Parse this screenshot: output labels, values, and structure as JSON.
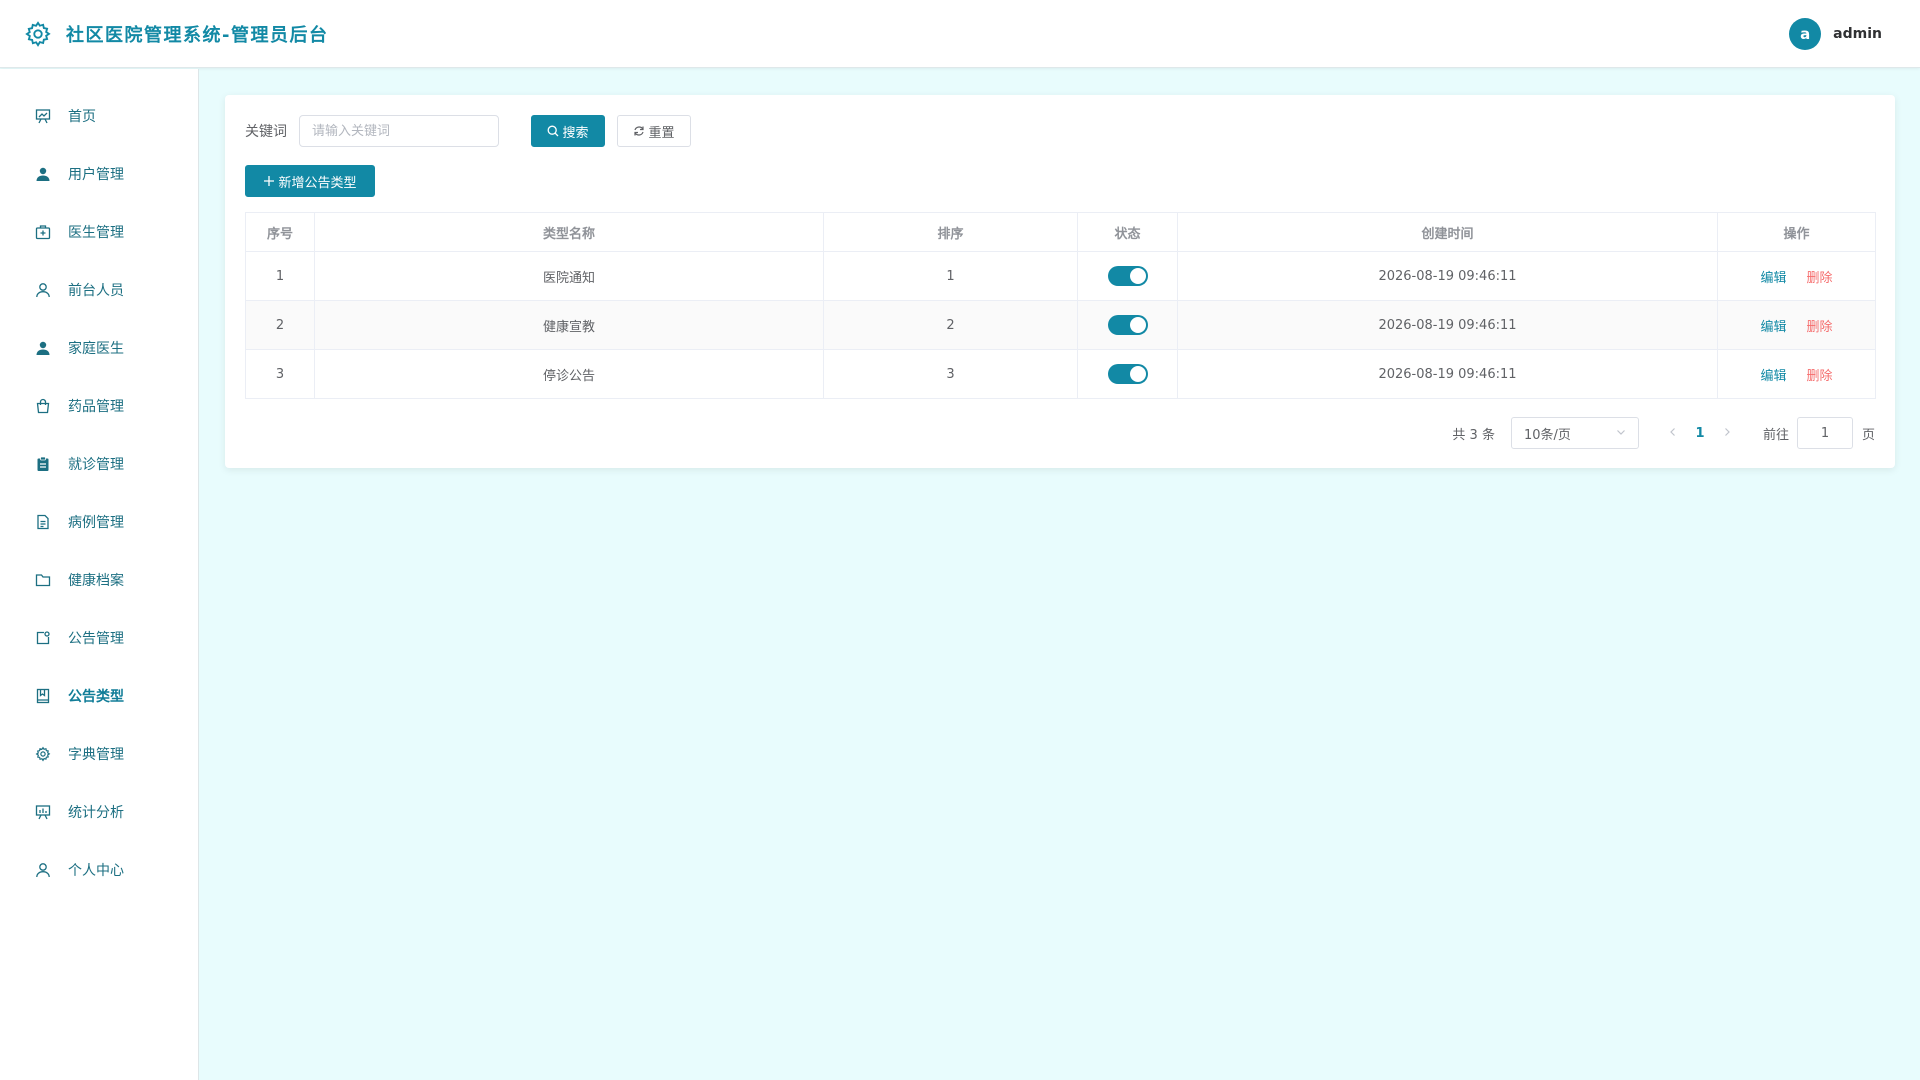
{
  "header": {
    "title": "社区医院管理系统-管理员后台",
    "user_initial": "a",
    "username": "admin"
  },
  "sidebar": {
    "items": [
      {
        "label": "首页",
        "icon": "dashboard-icon"
      },
      {
        "label": "用户管理",
        "icon": "user-filled-icon"
      },
      {
        "label": "医生管理",
        "icon": "medical-box-icon"
      },
      {
        "label": "前台人员",
        "icon": "user-outline-icon"
      },
      {
        "label": "家庭医生",
        "icon": "user-filled-icon"
      },
      {
        "label": "药品管理",
        "icon": "shopping-bag-icon"
      },
      {
        "label": "就诊管理",
        "icon": "clipboard-icon"
      },
      {
        "label": "病例管理",
        "icon": "document-icon"
      },
      {
        "label": "健康档案",
        "icon": "folder-icon"
      },
      {
        "label": "公告管理",
        "icon": "notice-icon"
      },
      {
        "label": "公告类型",
        "icon": "notebook-icon"
      },
      {
        "label": "字典管理",
        "icon": "gear-icon"
      },
      {
        "label": "统计分析",
        "icon": "chart-board-icon"
      },
      {
        "label": "个人中心",
        "icon": "user-outline-icon"
      }
    ],
    "active_index": 10
  },
  "search": {
    "label": "关键词",
    "placeholder": "请输入关键词",
    "value": "",
    "search_label": "搜索",
    "reset_label": "重置"
  },
  "toolbar": {
    "add_label": "新增公告类型"
  },
  "table": {
    "columns": [
      "序号",
      "类型名称",
      "排序",
      "状态",
      "创建时间",
      "操作"
    ],
    "rows": [
      {
        "no": "1",
        "name": "医院通知",
        "sort": "1",
        "status": true,
        "created": "2026-08-19 09:46:11"
      },
      {
        "no": "2",
        "name": "健康宣教",
        "sort": "2",
        "status": true,
        "created": "2026-08-19 09:46:11"
      },
      {
        "no": "3",
        "name": "停诊公告",
        "sort": "3",
        "status": true,
        "created": "2026-08-19 09:46:11"
      }
    ],
    "edit_label": "编辑",
    "delete_label": "删除"
  },
  "pagination": {
    "total_text": "共 3 条",
    "page_size": "10条/页",
    "current_page": "1",
    "goto_label": "前往",
    "goto_value": "1",
    "goto_suffix": "页"
  },
  "colors": {
    "accent": "#1289a5",
    "danger": "#f56c6c",
    "background": "#e8fcfd"
  }
}
